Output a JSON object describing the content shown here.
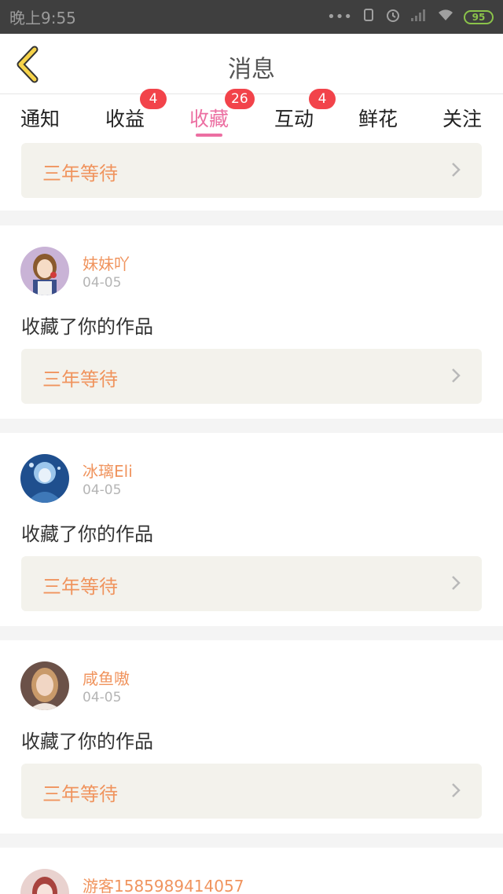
{
  "status_bar": {
    "time": "晚上9:55",
    "battery": "95",
    "icons": [
      "more-dots-icon",
      "screen-rotate-icon",
      "alarm-icon",
      "signal-icon",
      "wifi-icon",
      "battery-icon"
    ]
  },
  "header": {
    "title": "消息",
    "back_icon": "chevron-left-icon"
  },
  "tabs": [
    {
      "label": "通知",
      "badge": ""
    },
    {
      "label": "收益",
      "badge": "4"
    },
    {
      "label": "收藏",
      "badge": "26",
      "active": true
    },
    {
      "label": "互动",
      "badge": "4"
    },
    {
      "label": "鲜花",
      "badge": ""
    },
    {
      "label": "关注",
      "badge": ""
    }
  ],
  "colors": {
    "accent_pink": "#ec6fa2",
    "username_orange": "#f0945e",
    "badge_red": "#f2434a",
    "work_bg": "#f3f2ec"
  },
  "top_partial_card": {
    "work_title": "三年等待"
  },
  "notifications": [
    {
      "username": "妹妹吖",
      "date": "04-05",
      "action": "收藏了你的作品",
      "work_title": "三年等待"
    },
    {
      "username": "冰璃Eli",
      "date": "04-05",
      "action": "收藏了你的作品",
      "work_title": "三年等待"
    },
    {
      "username": "咸鱼嗷",
      "date": "04-05",
      "action": "收藏了你的作品",
      "work_title": "三年等待"
    },
    {
      "username": "游客1585989414057",
      "date": "",
      "action": "",
      "work_title": ""
    }
  ]
}
